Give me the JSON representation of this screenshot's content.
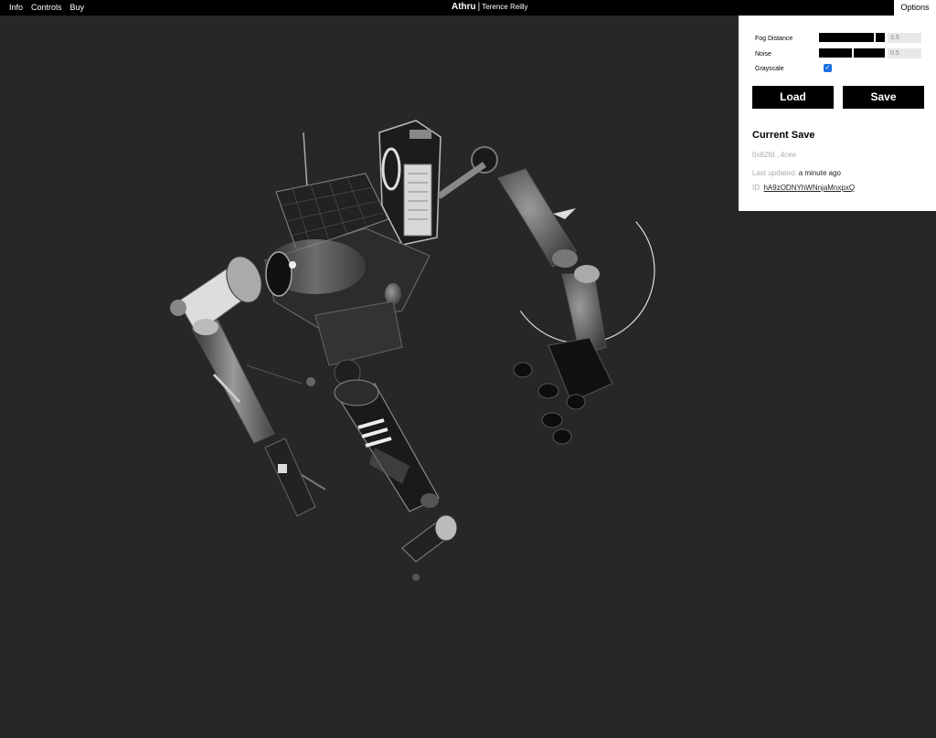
{
  "nav": {
    "info": "Info",
    "controls": "Controls",
    "buy": "Buy"
  },
  "brand": {
    "title": "Athru",
    "separator": "|",
    "author": "Terence Reilly"
  },
  "options_tab": "Options",
  "options": {
    "fog_distance": {
      "label": "Fog Distance",
      "value": "3.5",
      "level": 0.95
    },
    "noise": {
      "label": "Noise",
      "value": "0.5",
      "level": 0.5
    },
    "grayscale": {
      "label": "Grayscale",
      "checked": true
    }
  },
  "buttons": {
    "load": "Load",
    "save": "Save"
  },
  "current_save": {
    "title": "Current Save",
    "hash": "0x62fd...4cee",
    "updated_label": "Last updated:",
    "updated_value": "a minute ago",
    "id_label": "ID:",
    "id_value": "hA9zODNYhWNnjaMnxpxQ"
  },
  "colors": {
    "background": "#272727",
    "bar": "#000000",
    "checkbox": "#1a6fe0"
  }
}
